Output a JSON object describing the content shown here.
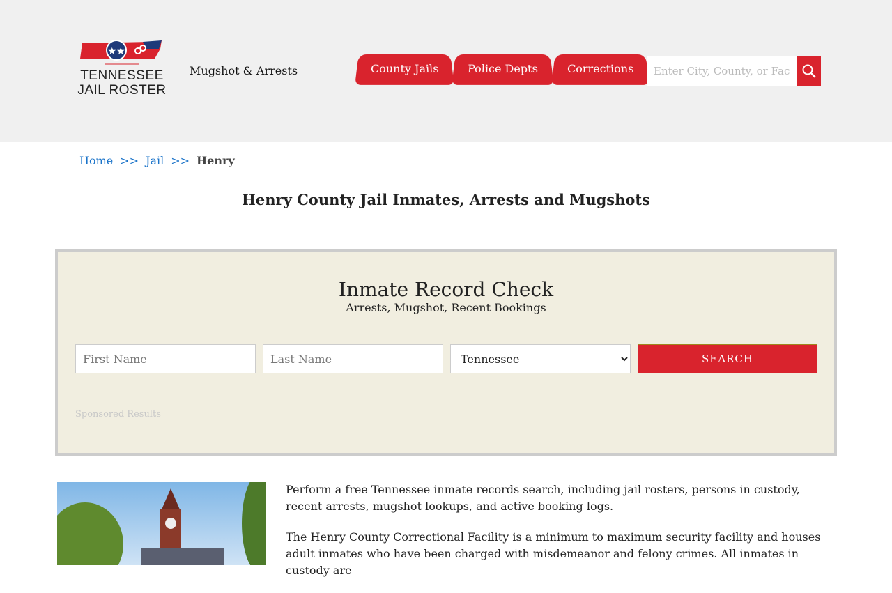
{
  "header": {
    "logo_text_1": "TENNESSEE",
    "logo_text_2": "JAIL ROSTER",
    "tagline": "Mugshot & Arrests",
    "nav": [
      "County Jails",
      "Police Depts",
      "Corrections"
    ],
    "search_placeholder": "Enter City, County, or Facility"
  },
  "breadcrumb": {
    "home": "Home",
    "sep": ">>",
    "jail": "Jail",
    "current": "Henry"
  },
  "page_title": "Henry County Jail Inmates, Arrests and Mugshots",
  "record_check": {
    "title": "Inmate Record Check",
    "subtitle": "Arrests, Mugshot, Recent Bookings",
    "first_placeholder": "First Name",
    "last_placeholder": "Last Name",
    "state": "Tennessee",
    "search_label": "SEARCH",
    "sponsored": "Sponsored Results"
  },
  "content": {
    "p1": "Perform a free Tennessee inmate records search, including jail rosters, persons in custody, recent arrests, mugshot lookups, and active booking logs.",
    "p2": "The Henry County Correctional Facility is a minimum to maximum security facility and houses adult inmates who have been charged with misdemeanor and felony crimes. All inmates in custody are"
  }
}
